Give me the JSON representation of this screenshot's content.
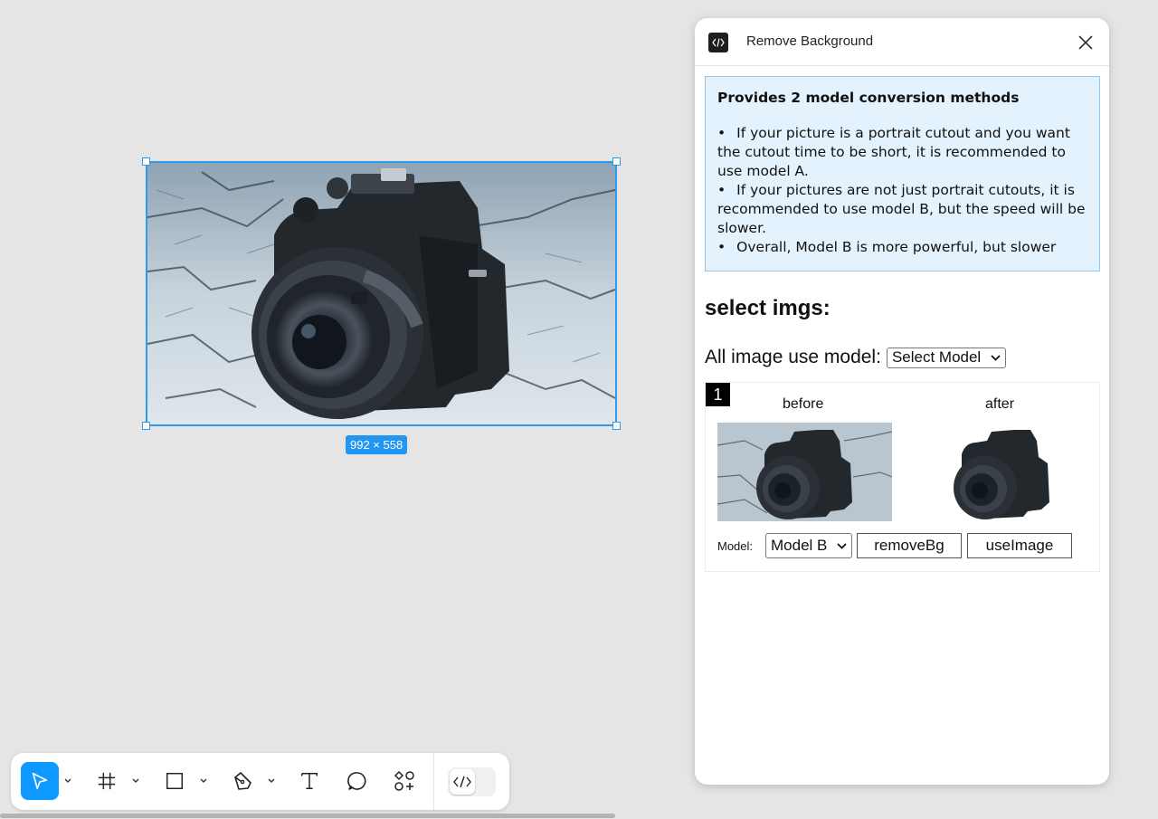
{
  "canvas": {
    "selection_size_label": "992 × 558"
  },
  "toolbar": {
    "tools": [
      {
        "icon": "move-pointer-icon",
        "active": true
      },
      {
        "icon": "frame-icon"
      },
      {
        "icon": "rectangle-icon"
      },
      {
        "icon": "pen-icon"
      },
      {
        "icon": "text-icon"
      },
      {
        "icon": "comment-icon"
      },
      {
        "icon": "actions-icon"
      }
    ],
    "dev_mode_icon": "code-icon"
  },
  "plugin": {
    "title": "Remove Background",
    "info": {
      "heading": "Provides 2 model conversion methods",
      "items": [
        "If your picture is a portrait cutout and you want the cutout time to be short, it is recommended to use model A.",
        "If your pictures are not just portrait cutouts, it is recommended to use model B, but the speed will be slower.",
        "Overall, Model B is more powerful, but slower"
      ]
    },
    "select_heading": "select imgs:",
    "all_model_label": "All image use model:",
    "all_model_select": "Select Model",
    "images": [
      {
        "index": "1",
        "before_label": "before",
        "after_label": "after",
        "model_label": "Model:",
        "model_value": "Model B",
        "remove_button": "removeBg",
        "use_button": "useImage"
      }
    ]
  },
  "colors": {
    "selection": "#2f9ae8",
    "accent": "#0d99ff",
    "info_bg": "#e3f2fd",
    "info_border": "#90c8f0"
  }
}
